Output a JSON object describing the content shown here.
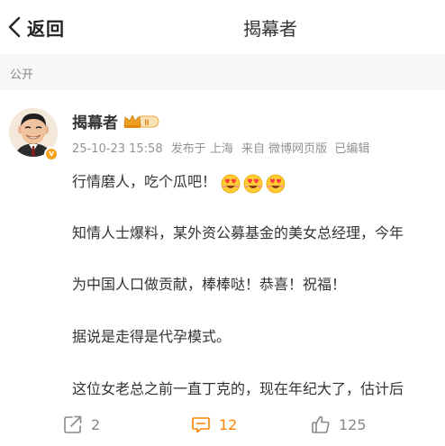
{
  "nav": {
    "back_label": "返回",
    "title": "揭幕者"
  },
  "visibility": "公开",
  "post": {
    "author": "揭幕者",
    "vip_badge_text": "II",
    "verified_badge_text": "v",
    "timestamp": "25-10-23 15:58",
    "published_location": "发布于 上海",
    "source": "来自 微博网页版",
    "edited": "已编辑",
    "paragraphs": [
      "行情磨人，吃个瓜吧！",
      "知情人士爆料，某外资公募基金的美女总经理，今年",
      "为中国人口做贡献，棒棒哒！恭喜！祝福！",
      "据说是走得是代孕模式。",
      "这位女老总之前一直丁克的，现在年纪大了，估计后"
    ],
    "emoji_names": [
      "heart-eyes-face-icon",
      "heart-eyes-face-icon",
      "heart-eyes-face-icon"
    ]
  },
  "actions": {
    "share_count": "2",
    "comment_count": "12",
    "like_count": "125"
  },
  "colors": {
    "accent": "#ff8200",
    "muted": "#939393",
    "text": "#333333",
    "bar_bg": "#f7f7f7"
  }
}
